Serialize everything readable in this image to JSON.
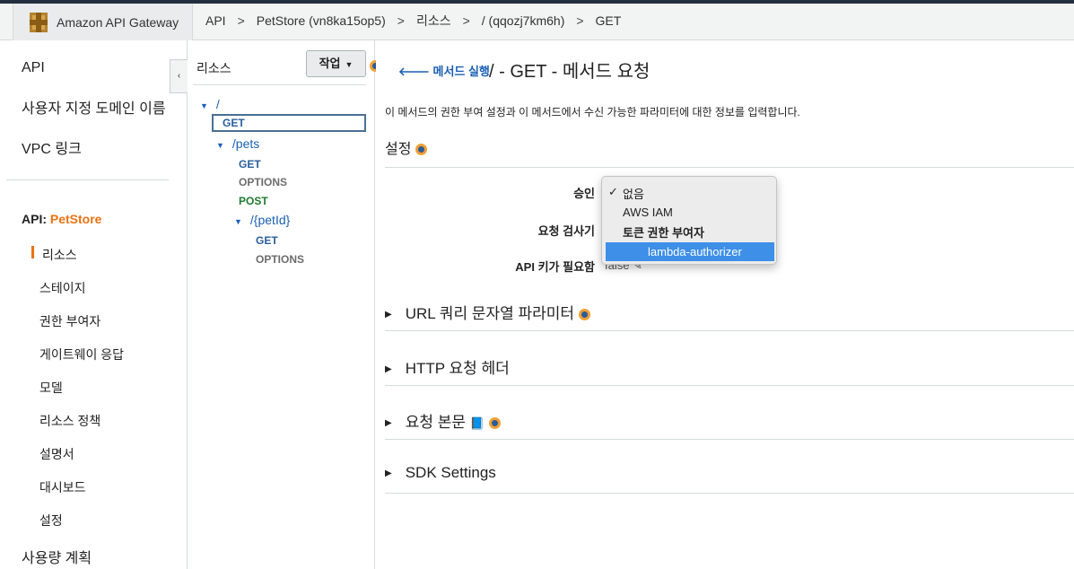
{
  "breadcrumb": {
    "brand": "Amazon API Gateway",
    "items": [
      "API",
      "PetStore (vn8ka15op5)",
      "리소스",
      "/ (qqozj7km6h)",
      "GET"
    ],
    "separator": ">"
  },
  "leftnav": {
    "top_items": [
      "API",
      "사용자 지정 도메인 이름",
      "VPC 링크"
    ],
    "api_prefix": "API: ",
    "api_name": "PetStore",
    "sub_items": [
      "리소스",
      "스테이지",
      "권한 부여자",
      "게이트웨이 응답",
      "모델",
      "리소스 정책",
      "설명서",
      "대시보드",
      "설정"
    ],
    "bottom_item": "사용량 계획",
    "collapse_icon": "‹"
  },
  "tree": {
    "title": "리소스",
    "action_label": "작업",
    "root": "/",
    "root_get": "GET",
    "pets": "/pets",
    "pets_methods": [
      "GET",
      "OPTIONS",
      "POST"
    ],
    "petid": "/{petId}",
    "petid_methods": [
      "GET",
      "OPTIONS"
    ]
  },
  "main": {
    "back_label": "메서드 실행",
    "title": "/ - GET - 메서드 요청",
    "description": "이 메서드의 권한 부여 설정과 이 메서드에서 수신 가능한 파라미터에 대한 정보를 입력합니다.",
    "settings_title": "설정",
    "labels": {
      "auth": "승인",
      "validator": "요청 검사기",
      "api_key": "API 키가 필요함"
    },
    "api_key_value": "false",
    "sections": [
      "URL 쿼리 문자열 파라미터",
      "HTTP 요청 헤더",
      "요청 본문",
      "SDK Settings"
    ]
  },
  "dropdown": {
    "options": [
      "없음",
      "AWS IAM"
    ],
    "group_label": "토큰 권한 부여자",
    "selected": "lambda-authorizer",
    "check": "✓"
  },
  "colors": {
    "accent": "#ec7211",
    "link": "#1a5fb4",
    "selection": "#3d8fe8"
  }
}
